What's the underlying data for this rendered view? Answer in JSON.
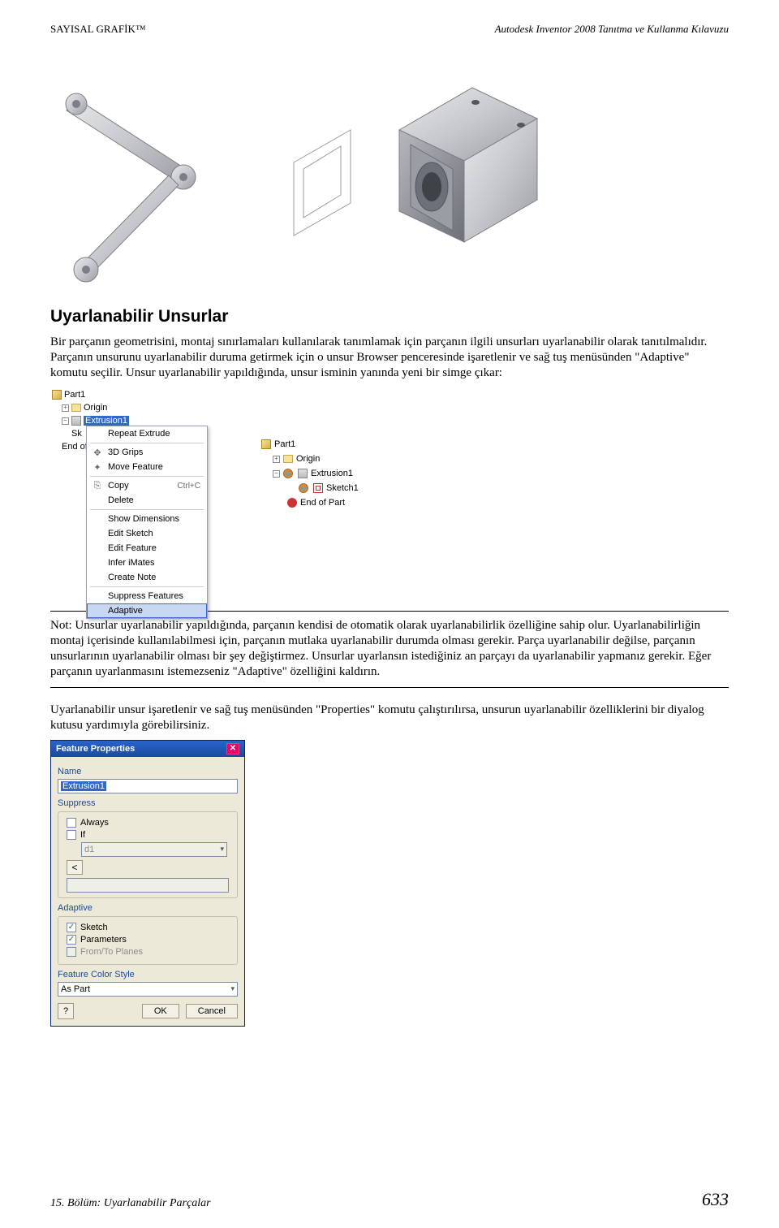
{
  "header": {
    "left": "SAYISAL GRAFİK™",
    "right": "Autodesk Inventor 2008 Tanıtma ve Kullanma Kılavuzu"
  },
  "section_title": "Uyarlanabilir Unsurlar",
  "para1": "Bir parçanın geometrisini, montaj sınırlamaları kullanılarak tanımlamak için parçanın ilgili unsurları uyarlanabilir olarak tanıtılmalıdır. Parçanın unsurunu uyarlanabilir duruma getirmek için o unsur Browser penceresinde işaretlenir ve sağ tuş menüsünden \"Adaptive\" komutu seçilir. Unsur uyarlanabilir yapıldığında, unsur isminin yanında yeni bir simge çıkar:",
  "note": "Not: Unsurlar uyarlanabilir yapıldığında, parçanın kendisi de otomatik olarak uyarlanabilirlik özelliğine sahip olur. Uyarlanabilirliğin montaj içerisinde kullanılabilmesi için, parçanın mutlaka uyarlanabilir durumda olması gerekir. Parça uyarlanabilir değilse, parçanın unsurlarının uyarlanabilir olması bir şey değiştirmez. Unsurlar uyarlansın istediğiniz an parçayı da uyarlanabilir yapmanız gerekir. Eğer parçanın uyarlanmasını istemezseniz \"Adaptive\" özelliğini kaldırın.",
  "para2": "Uyarlanabilir unsur işaretlenir ve sağ tuş menüsünden \"Properties\" komutu çalıştırılırsa, unsurun uyarlanabilir özelliklerini bir diyalog kutusu yardımıyla görebilirsiniz.",
  "browser_tree": {
    "part": "Part1",
    "origin": "Origin",
    "selected": "Extrusion1",
    "sketch": "Sk",
    "end": "End of"
  },
  "context_menu": {
    "items": [
      "Repeat Extrude",
      "3D Grips",
      "Move Feature",
      "Copy",
      "Delete",
      "Show Dimensions",
      "Edit Sketch",
      "Edit Feature",
      "Infer iMates",
      "Create Note",
      "Suppress Features",
      "Adaptive"
    ],
    "copy_shortcut": "Ctrl+C"
  },
  "tree2": {
    "part": "Part1",
    "origin": "Origin",
    "extr": "Extrusion1",
    "sketch": "Sketch1",
    "end": "End of Part"
  },
  "dialog": {
    "title": "Feature Properties",
    "name_label": "Name",
    "name_value": "Extrusion1",
    "suppress_label": "Suppress",
    "always": "Always",
    "if_label": "If",
    "d1": "d1",
    "lt": "<",
    "adaptive_label": "Adaptive",
    "sketch": "Sketch",
    "params": "Parameters",
    "fromto": "From/To Planes",
    "fcs_label": "Feature Color Style",
    "fcs_value": "As Part",
    "ok": "OK",
    "cancel": "Cancel"
  },
  "footer": {
    "chapter": "15. Bölüm: Uyarlanabilir Parçalar",
    "page": "633"
  }
}
